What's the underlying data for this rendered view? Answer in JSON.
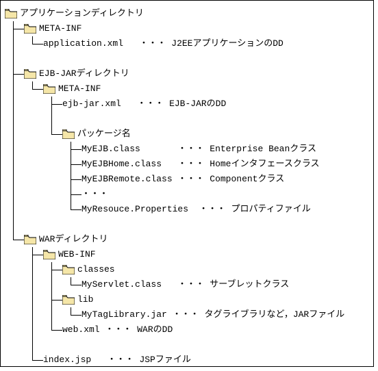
{
  "tree": {
    "root": {
      "name": "アプリケーションディレクトリ",
      "children": {
        "metaInf": {
          "name": "META-INF",
          "appXml": "application.xml",
          "appXmlDesc": "J2EEアプリケーションのDD"
        },
        "ejbJar": {
          "name": "EJB-JARディレクトリ",
          "metaInf": {
            "name": "META-INF",
            "ejbJarXml": "ejb-jar.xml",
            "ejbJarXmlDesc": "EJB-JARのDD"
          },
          "pkg": {
            "name": "パッケージ名",
            "myEjb": "MyEJB.class",
            "myEjbDesc": "Enterprise Beanクラス",
            "myEjbHome": "MyEJBHome.class",
            "myEjbHomeDesc": "Homeインタフェースクラス",
            "myEjbRemote": "MyEJBRemote.class",
            "myEjbRemoteDesc": "Componentクラス",
            "ellipsis": "・・・",
            "myResource": "MyResouce.Properties",
            "myResourceDesc": "プロパティファイル"
          }
        },
        "war": {
          "name": "WARディレクトリ",
          "webInf": {
            "name": "WEB-INF",
            "classes": {
              "name": "classes",
              "myServlet": "MyServlet.class",
              "myServletDesc": "サーブレットクラス"
            },
            "lib": {
              "name": "lib",
              "myTagLib": "MyTagLibrary.jar",
              "myTagLibDesc": "タグライブラリなど，JARファイル"
            },
            "webXml": "web.xml",
            "webXmlDesc": "WARのDD"
          },
          "indexJsp": "index.jsp",
          "indexJspDesc": "JSPファイル"
        }
      }
    }
  },
  "dots": "・・・"
}
